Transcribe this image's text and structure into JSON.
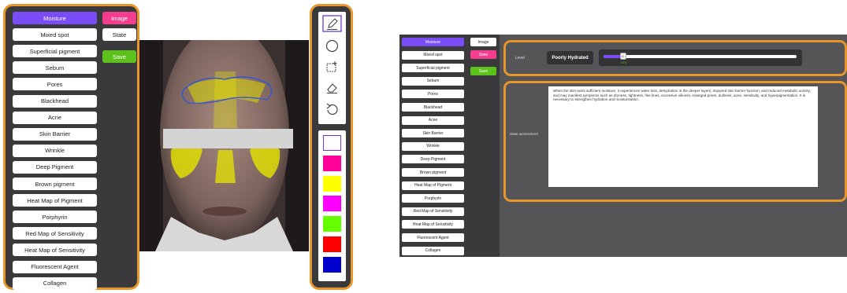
{
  "left_panel": {
    "items": [
      "Moisture",
      "Mixed spot",
      "Superficial pigment",
      "Sebum",
      "Pores",
      "Blackhead",
      "Acne",
      "Skin Barrier",
      "Wrinkle",
      "Deep Pigment",
      "Brown pigment",
      "Heat Map of Pigment",
      "Porphyrin",
      "Red Map of Sensitivity",
      "Heat Map of Sensitivity",
      "Fluorescent Agent",
      "Collagen"
    ],
    "active_index": 0,
    "image_label": "Image",
    "state_label": "State",
    "save_label": "Save"
  },
  "tools": [
    "pencil-icon",
    "circle-icon",
    "rectangle-icon",
    "eraser-icon",
    "undo-icon"
  ],
  "colors": [
    "#ffffff",
    "#ff0099",
    "#ffff00",
    "#ff00ff",
    "#66ff00",
    "#ff0000",
    "#0000cc"
  ],
  "right_screen": {
    "items": [
      "Moisture",
      "Mixed spot",
      "Superficial pigment",
      "Sebum",
      "Pores",
      "Blackhead",
      "Acne",
      "Skin Barrier",
      "Wrinkle",
      "Deep Pigment",
      "Brown pigment",
      "Heat Map of Pigment",
      "Porphyrin",
      "Red Map of Sensitivity",
      "Heat Map of Sensitivity",
      "Fluorescent Agent",
      "Collagen"
    ],
    "image_label": "Image",
    "state_label": "State",
    "save_label": "Save",
    "level_label": "Level",
    "level_value": "Poorly Hydrated",
    "slider_percent": 10,
    "slider_text": "10%",
    "slider_thumb": "6",
    "assessment_label": "State assessment",
    "assessment_text": "When the skin lacks sufficient moisture, it experiences water loss, dehydration in the deeper layers, impaired skin barrier function, and reduced metabolic activity, and may manifest symptoms such as dryness, tightness, fine lines, excessive oiliness, enlarged pores, dullness, acne, sensitivity, and hyperpigmentation. It is necessary to strengthen hydration and moisturization."
  }
}
